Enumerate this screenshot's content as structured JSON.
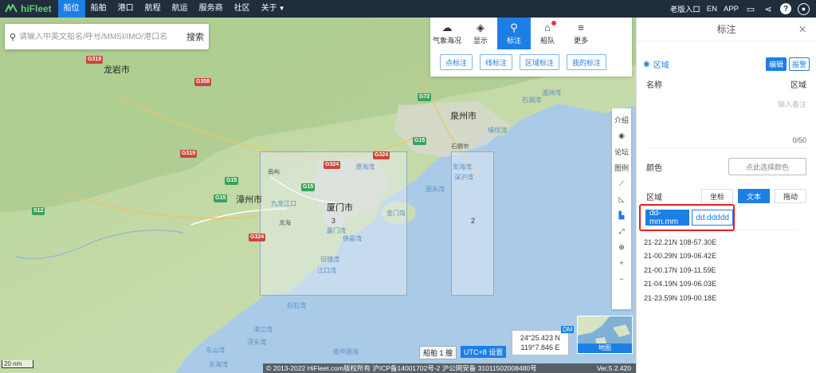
{
  "topbar": {
    "logo": "hiFleet",
    "nav": [
      {
        "label": "船位",
        "active": true
      },
      {
        "label": "船舶"
      },
      {
        "label": "港口"
      },
      {
        "label": "航程"
      },
      {
        "label": "航运"
      },
      {
        "label": "服务商"
      },
      {
        "label": "社区"
      },
      {
        "label": "关于"
      }
    ],
    "right": {
      "old_version": "老版入口",
      "lang": "EN",
      "app": "APP"
    }
  },
  "search": {
    "placeholder": "请输入中英文船名/呼号/MMSI/IMO/港口名",
    "button": "搜索"
  },
  "toolbox": {
    "tools": [
      {
        "label": "气象海况",
        "icon": "weather-icon"
      },
      {
        "label": "显示",
        "icon": "layers-icon"
      },
      {
        "label": "标注",
        "icon": "pin-icon",
        "active": true
      },
      {
        "label": "船队",
        "icon": "fleet-icon"
      },
      {
        "label": "更多",
        "icon": "menu-icon"
      }
    ],
    "marks": [
      "点标注",
      "线标注",
      "区域标注",
      "我的标注"
    ]
  },
  "side_strip": {
    "items": [
      "介绍",
      "论坛",
      "图例"
    ]
  },
  "map": {
    "places": {
      "longyan": "龙岩市",
      "quanzhou": "泉州市",
      "zhangzhou": "漳州市",
      "xiamen": "厦门市",
      "jiulong": "九龙江口",
      "xiamen_bay": "厦门湾",
      "dengyu": "澄海湾",
      "jinmen": "金门岛",
      "weitou": "围头湾",
      "anhai": "安海湾",
      "shenhu": "深沪湾",
      "weitou2": "围头湾",
      "longhai": "龙海",
      "nanyou": "南屿",
      "dongshan": "东山湾",
      "houtang": "后石湾",
      "shitang": "石狮市",
      "nanzhong": "南中国海",
      "fushou": "浮头湾",
      "xigu": "漳江湾",
      "meizhou": "湄洲湾",
      "pudi": "埔埕湾",
      "shizhou": "石湖湾",
      "donghai": "东海湾",
      "jiangkou": "江口湾",
      "zhuyu": "佛昙湾",
      "lvhu": "旧镇湾"
    },
    "roads": [
      "G319",
      "G358",
      "G319",
      "G15",
      "G324",
      "G15",
      "G72",
      "G15",
      "G324",
      "G324",
      "G15",
      "S12"
    ],
    "zones": [
      "3",
      "2"
    ],
    "coord": {
      "lat": "24°25.423 N",
      "lon": "119°7.846 E"
    },
    "dm": "DM",
    "minimap_label": "地图",
    "ship_count": "船舶 1 艘",
    "utc": "UTC+8 设置",
    "scale": "20 nm",
    "footer": "© 2013-2022 HiFleet.com版权所有 沪ICP备14001702号-2 沪公网安备 31011502008480号",
    "version": "Ver.5.2.420"
  },
  "panel": {
    "title": "标注",
    "region": "区域",
    "edit": "编辑",
    "alarm": "报警",
    "name_label": "名称",
    "name_value": "区域",
    "note_label": "备注",
    "note_placeholder": "输入备注",
    "counter": "0/50",
    "color_label": "颜色",
    "color_button": "点此选择颜色",
    "area_label": "区域",
    "area_tabs": [
      {
        "label": "坐标"
      },
      {
        "label": "文本",
        "active": true
      },
      {
        "label": "拖动"
      }
    ],
    "formats": [
      {
        "label": "dd-mm.mm",
        "active": true
      },
      {
        "label": "dd.ddddd"
      }
    ],
    "coords": [
      "21-22.21N 108-57.30E",
      "21-00.29N 109-06.42E",
      "21-00.17N 109-11.59E",
      "21-04.19N 109-06.03E",
      "21-23.59N 109-00.18E"
    ]
  },
  "colors": {
    "accent": "#1d7fe5",
    "topbar": "#1f2d3d",
    "highlight": "#e02020"
  }
}
